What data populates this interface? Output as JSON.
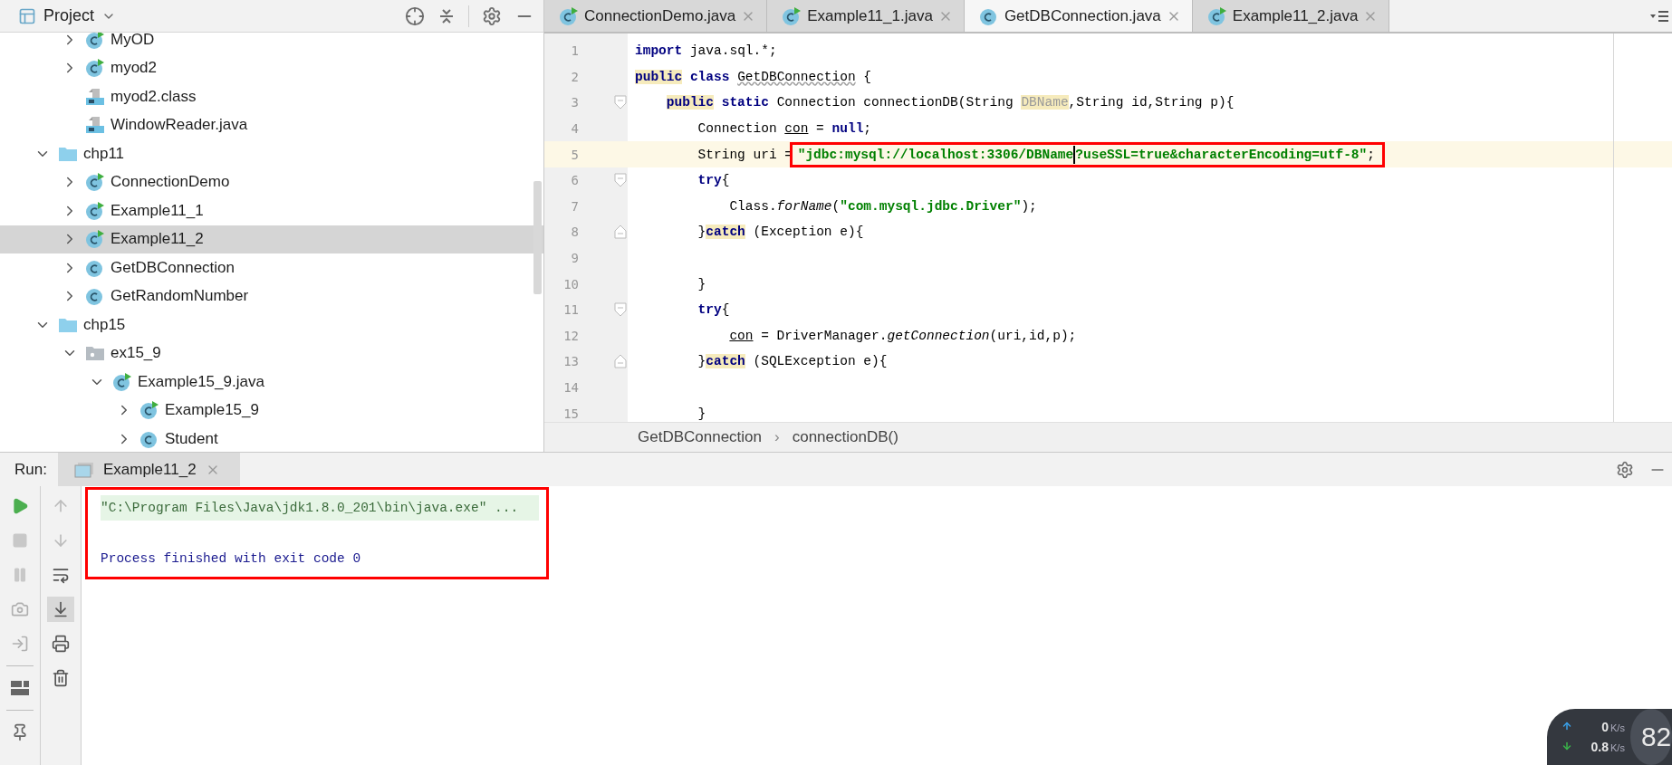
{
  "project": {
    "title": "Project",
    "continued_items": [
      {
        "label": "MyOD",
        "kind": "class-run",
        "expanded": false,
        "selected": false
      },
      {
        "label": "myod2",
        "kind": "class-run",
        "expanded": false,
        "selected": false
      },
      {
        "label": "myod2.class",
        "kind": "classfile",
        "selected": false
      },
      {
        "label": "WindowReader.java",
        "kind": "javafile",
        "selected": false
      }
    ],
    "items": [
      {
        "label": "chp11",
        "kind": "folder",
        "expanded": true,
        "selected": false,
        "children": [
          {
            "label": "ConnectionDemo",
            "kind": "class-run",
            "expanded": false,
            "selected": false
          },
          {
            "label": "Example11_1",
            "kind": "class-run",
            "expanded": false,
            "selected": false
          },
          {
            "label": "Example11_2",
            "kind": "class-run",
            "expanded": false,
            "selected": true
          },
          {
            "label": "GetDBConnection",
            "kind": "class",
            "expanded": false,
            "selected": false
          },
          {
            "label": "GetRandomNumber",
            "kind": "class",
            "expanded": false,
            "selected": false
          }
        ]
      },
      {
        "label": "chp15",
        "kind": "folder",
        "expanded": true,
        "selected": false,
        "children": [
          {
            "label": "ex15_9",
            "kind": "package",
            "expanded": true,
            "selected": false,
            "children": [
              {
                "label": "Example15_9.java",
                "kind": "class-run",
                "expanded": true,
                "selected": false,
                "children": [
                  {
                    "label": "Example15_9",
                    "kind": "class-run",
                    "expanded": false,
                    "selected": false
                  },
                  {
                    "label": "Student",
                    "kind": "class",
                    "expanded": false,
                    "selected": false
                  }
                ]
              }
            ]
          }
        ]
      }
    ]
  },
  "editor": {
    "tabs": [
      {
        "label": "ConnectionDemo.java",
        "kind": "class-run",
        "selected": false
      },
      {
        "label": "Example11_1.java",
        "kind": "class-run",
        "selected": false
      },
      {
        "label": "GetDBConnection.java",
        "kind": "class",
        "selected": true
      },
      {
        "label": "Example11_2.java",
        "kind": "class-run",
        "selected": false
      }
    ],
    "lines": [
      {
        "number": "1",
        "selected": false,
        "tokens": [
          {
            "kind": "kw",
            "t": "import"
          },
          {
            "kind": "plain",
            "t": " java.sql.*;"
          }
        ]
      },
      {
        "number": "2",
        "selected": false,
        "tokens": [
          {
            "kind": "kw",
            "t": "public",
            "hl": true
          },
          {
            "kind": "kw",
            "t": " class "
          },
          {
            "kind": "warn",
            "t": "GetDBConnection"
          },
          {
            "kind": "plain",
            "t": " {"
          }
        ],
        "children": [
          {
            "number": "3",
            "selected": false,
            "fold_start": true,
            "tokens": [
              {
                "kind": "kw",
                "t": "public",
                "hl": true
              },
              {
                "kind": "kw",
                "t": " static"
              },
              {
                "kind": "plain",
                "t": " Connection connectionDB(String "
              },
              {
                "kind": "param",
                "t": "DBName",
                "hl": true
              },
              {
                "kind": "plain",
                "t": ",String id,String p){"
              }
            ],
            "children": [
              {
                "number": "4",
                "selected": false,
                "tokens": [
                  {
                    "kind": "plain",
                    "t": "Connection "
                  },
                  {
                    "kind": "ref",
                    "t": "con"
                  },
                  {
                    "kind": "plain",
                    "t": " = "
                  },
                  {
                    "kind": "kw",
                    "t": "null"
                  },
                  {
                    "kind": "plain",
                    "t": ";"
                  }
                ]
              },
              {
                "number": "5",
                "selected": true,
                "tokens": [
                  {
                    "kind": "plain",
                    "t": "String uri = "
                  },
                  {
                    "kind": "boxed",
                    "parts": [
                      {
                        "kind": "str",
                        "t": "\"jdbc:mysql://localhost:3306/DBName"
                      },
                      {
                        "kind": "caret"
                      },
                      {
                        "kind": "str",
                        "t": "?useSSL=true&characterEncoding=utf-8\""
                      },
                      {
                        "kind": "plain",
                        "t": ";"
                      }
                    ]
                  }
                ]
              },
              {
                "number": "6",
                "selected": false,
                "fold_start": true,
                "tokens": [
                  {
                    "kind": "kw",
                    "t": "try"
                  },
                  {
                    "kind": "plain",
                    "t": "{"
                  }
                ],
                "children": [
                  {
                    "number": "7",
                    "selected": false,
                    "tokens": [
                      {
                        "kind": "plain",
                        "t": "Class."
                      },
                      {
                        "kind": "italic",
                        "t": "forName"
                      },
                      {
                        "kind": "plain",
                        "t": "("
                      },
                      {
                        "kind": "str",
                        "t": "\"com.mysql.jdbc.Driver\""
                      },
                      {
                        "kind": "plain",
                        "t": ");"
                      }
                    ]
                  }
                ]
              },
              {
                "number": "8",
                "selected": false,
                "fold_end": true,
                "tokens": [
                  {
                    "kind": "plain",
                    "t": "}"
                  },
                  {
                    "kind": "kw",
                    "t": "catch",
                    "hl": true
                  },
                  {
                    "kind": "plain",
                    "t": " (Exception e){"
                  }
                ],
                "children": [
                  {
                    "number": "9",
                    "selected": false
                  }
                ]
              },
              {
                "number": "10",
                "selected": false,
                "tokens": [
                  {
                    "kind": "plain",
                    "t": "}"
                  }
                ]
              },
              {
                "number": "11",
                "selected": false,
                "fold_start": true,
                "tokens": [
                  {
                    "kind": "kw",
                    "t": "try"
                  },
                  {
                    "kind": "plain",
                    "t": "{"
                  }
                ],
                "children": [
                  {
                    "number": "12",
                    "selected": false,
                    "tokens": [
                      {
                        "kind": "ref",
                        "t": "con"
                      },
                      {
                        "kind": "plain",
                        "t": " = DriverManager."
                      },
                      {
                        "kind": "italic",
                        "t": "getConnection"
                      },
                      {
                        "kind": "plain",
                        "t": "(uri,id,p);"
                      }
                    ]
                  }
                ]
              },
              {
                "number": "13",
                "selected": false,
                "fold_end": true,
                "tokens": [
                  {
                    "kind": "plain",
                    "t": "}"
                  },
                  {
                    "kind": "kw",
                    "t": "catch",
                    "hl": true
                  },
                  {
                    "kind": "plain",
                    "t": " (SQLException e){"
                  }
                ],
                "children": [
                  {
                    "number": "14",
                    "selected": false
                  }
                ]
              },
              {
                "number": "15",
                "selected": false,
                "tokens": [
                  {
                    "kind": "plain",
                    "t": "}"
                  }
                ]
              }
            ]
          }
        ]
      }
    ],
    "breadcrumb": [
      "GetDBConnection",
      "connectionDB()"
    ],
    "breadcrumb_separator": "›"
  },
  "run": {
    "label": "Run:",
    "tab": {
      "label": "Example11_2",
      "selected": true
    },
    "console": [
      {
        "kind": "command",
        "text": "\"C:\\Program Files\\Java\\jdk1.8.0_201\\bin\\java.exe\" ..."
      },
      {
        "kind": "blank"
      },
      {
        "kind": "info",
        "text": "Process finished with exit code 0"
      }
    ]
  },
  "net_widget": {
    "up": "0",
    "up_unit": "K/s",
    "down": "0.8",
    "down_unit": "K/s",
    "score": "82"
  }
}
